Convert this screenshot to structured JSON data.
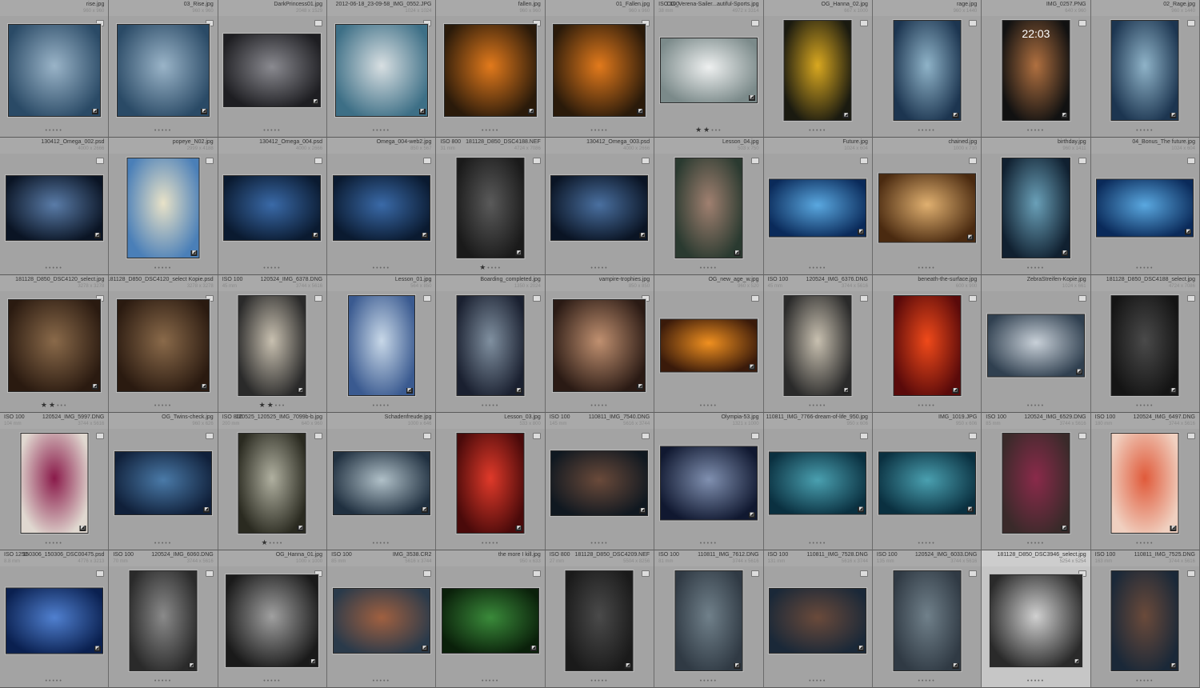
{
  "rows": [
    [
      {
        "name": "rise.jpg",
        "dims": "960 x 960",
        "w": 960,
        "h": 960,
        "stars": 0,
        "c": [
          "#2a4a66",
          "#9ab4c8"
        ]
      },
      {
        "name": "03_Rise.jpg",
        "dims": "960 x 960",
        "w": 960,
        "h": 960,
        "stars": 0,
        "c": [
          "#2a4a66",
          "#9ab4c8"
        ]
      },
      {
        "name": "DarkPrincess01.jpg",
        "dims": "2048 x 1529",
        "w": 2048,
        "h": 1529,
        "stars": 0,
        "c": [
          "#1e1e22",
          "#8a8a90"
        ]
      },
      {
        "name": "2012-06-18_23-09-58_IMG_0552.JPG",
        "dims": "1024 x 1024",
        "w": 1024,
        "h": 1024,
        "stars": 0,
        "c": [
          "#3d6f86",
          "#d8dfe2"
        ]
      },
      {
        "name": "fallen.jpg",
        "dims": "960 x 960",
        "w": 960,
        "h": 960,
        "stars": 0,
        "c": [
          "#2a1a0a",
          "#e27a1c"
        ]
      },
      {
        "name": "01_Fallen.jpg",
        "dims": "960 x 960",
        "w": 960,
        "h": 960,
        "stars": 0,
        "c": [
          "#2a1a0a",
          "#e27a1c"
        ]
      },
      {
        "name": "OG_Verena-Sailer...autiful-Sports.jpg",
        "dims": "4972 x 3314",
        "iso": "ISO 100",
        "focal": "38 mm",
        "w": 4972,
        "h": 3314,
        "stars": 2,
        "c": [
          "#7b8a8a",
          "#eef0f0"
        ]
      },
      {
        "name": "OG_Hanna_02.jpg",
        "dims": "667 x 1000",
        "w": 667,
        "h": 1000,
        "stars": 0,
        "c": [
          "#1a1a10",
          "#d9a820"
        ]
      },
      {
        "name": "rage.jpg",
        "dims": "960 x 1440",
        "w": 960,
        "h": 1440,
        "stars": 0,
        "c": [
          "#1c3550",
          "#8fb3c8"
        ]
      },
      {
        "name": "IMG_0257.PNG",
        "dims": "640 x 960",
        "w": 640,
        "h": 960,
        "stars": 0,
        "c": [
          "#111111",
          "#b07040"
        ],
        "clock": "22:03"
      },
      {
        "name": "02_Rage.jpg",
        "dims": "960 x 1440",
        "w": 960,
        "h": 1440,
        "stars": 0,
        "c": [
          "#1c3550",
          "#8fb3c8"
        ]
      }
    ],
    [
      {
        "name": "130412_Omega_002.psd",
        "dims": "4000 x 2666",
        "w": 4000,
        "h": 2666,
        "stars": 0,
        "c": [
          "#0a1424",
          "#5a7ca8"
        ]
      },
      {
        "name": "popeye_N02.jpg",
        "dims": "2999 x 4188",
        "w": 2999,
        "h": 4188,
        "stars": 0,
        "c": [
          "#4a7fb8",
          "#e8e2c8"
        ]
      },
      {
        "name": "130412_Omega_004.psd",
        "dims": "4000 x 2666",
        "w": 4000,
        "h": 2666,
        "stars": 0,
        "c": [
          "#0a1a30",
          "#3a6aa8"
        ]
      },
      {
        "name": "Omega_004-web2.jpg",
        "dims": "850 x 567",
        "w": 850,
        "h": 567,
        "stars": 0,
        "c": [
          "#0a1a30",
          "#3a6aa8"
        ]
      },
      {
        "name": "181128_D850_DSC4188.NEF",
        "dims": "4724 x 7086",
        "iso": "ISO 800",
        "focal": "31 mm",
        "w": 4724,
        "h": 7086,
        "stars": 1,
        "c": [
          "#1a1a1a",
          "#5a5a5a"
        ]
      },
      {
        "name": "130412_Omega_003.psd",
        "dims": "4000 x 2666",
        "w": 4000,
        "h": 2666,
        "stars": 0,
        "c": [
          "#0a1424",
          "#4a70a0"
        ]
      },
      {
        "name": "Lesson_04.jpg",
        "dims": "503 x 750",
        "w": 503,
        "h": 750,
        "stars": 0,
        "c": [
          "#2a3a30",
          "#a08070"
        ]
      },
      {
        "name": "Future.jpg",
        "dims": "1024 x 604",
        "w": 1024,
        "h": 604,
        "stars": 0,
        "c": [
          "#0a2a5a",
          "#5aa8e0"
        ]
      },
      {
        "name": "chained.jpg",
        "dims": "1000 x 710",
        "w": 1000,
        "h": 710,
        "stars": 0,
        "c": [
          "#4a2a10",
          "#e0b070"
        ]
      },
      {
        "name": "birthday.jpg",
        "dims": "960 x 1411",
        "w": 960,
        "h": 1411,
        "stars": 0,
        "c": [
          "#102030",
          "#6aa0b8"
        ]
      },
      {
        "name": "04_Bonus_The future.jpg",
        "dims": "1024 x 604",
        "w": 1024,
        "h": 604,
        "stars": 0,
        "c": [
          "#0a2a5a",
          "#5aa8e0"
        ]
      }
    ],
    [
      {
        "name": "181128_D850_DSC4120_select.jpg",
        "dims": "3278 x 3278",
        "w": 3278,
        "h": 3278,
        "stars": 2,
        "c": [
          "#2a1a10",
          "#8a6a4a"
        ]
      },
      {
        "name": "181128_D850_DSC4120_select Kopie.psd",
        "dims": "3278 x 3278",
        "w": 3278,
        "h": 3278,
        "stars": 0,
        "c": [
          "#2a1a10",
          "#8a6a4a"
        ]
      },
      {
        "name": "120524_IMG_6378.DNG",
        "dims": "3744 x 5616",
        "iso": "ISO 100",
        "focal": "45 mm",
        "w": 3744,
        "h": 5616,
        "stars": 2,
        "c": [
          "#2a2a2a",
          "#c8c0b0"
        ]
      },
      {
        "name": "Lesson_01.jpg",
        "dims": "564 x 850",
        "w": 564,
        "h": 850,
        "stars": 0,
        "c": [
          "#3a5a90",
          "#c8d8e8"
        ]
      },
      {
        "name": "Boarding_completed.jpg",
        "dims": "1350 x 2024",
        "w": 1350,
        "h": 2024,
        "stars": 0,
        "c": [
          "#1a2030",
          "#8090a0"
        ]
      },
      {
        "name": "vampire-trophies.jpg",
        "dims": "850 x 850",
        "w": 850,
        "h": 850,
        "stars": 0,
        "c": [
          "#2a1a14",
          "#c09070"
        ]
      },
      {
        "name": "OG_new_age_w.jpg",
        "dims": "960 x 520",
        "w": 960,
        "h": 520,
        "stars": 0,
        "c": [
          "#3a1a0a",
          "#f09020"
        ]
      },
      {
        "name": "120524_IMG_6376.DNG",
        "dims": "3744 x 5616",
        "iso": "ISO 100",
        "focal": "45 mm",
        "w": 3744,
        "h": 5616,
        "stars": 0,
        "c": [
          "#2a2a2a",
          "#c8c0b0"
        ]
      },
      {
        "name": "beneath-the-surface.jpg",
        "dims": "600 x 900",
        "w": 600,
        "h": 900,
        "stars": 0,
        "c": [
          "#5a0a0a",
          "#f04a1a"
        ]
      },
      {
        "name": "ZebraStreifen-Kopie.jpg",
        "dims": "1024 x 661",
        "w": 1024,
        "h": 661,
        "stars": 0,
        "c": [
          "#304050",
          "#c8d0d8"
        ]
      },
      {
        "name": "181128_D850_DSC4188_select.jpg",
        "dims": "4724 x 7086",
        "w": 4724,
        "h": 7086,
        "stars": 0,
        "c": [
          "#141414",
          "#4a4a4a"
        ]
      }
    ],
    [
      {
        "name": "120524_IMG_5997.DNG",
        "dims": "3744 x 5616",
        "iso": "ISO 100",
        "focal": "104 mm",
        "w": 3744,
        "h": 5616,
        "stars": 0,
        "c": [
          "#e0d8d0",
          "#8a1a4a"
        ]
      },
      {
        "name": "OG_Twins-check.jpg",
        "dims": "960 x 626",
        "w": 960,
        "h": 626,
        "stars": 0,
        "c": [
          "#10203a",
          "#4a7aa8"
        ]
      },
      {
        "name": "120525_120525_IMG_7099b-b.jpg",
        "dims": "640 x 960",
        "iso": "ISO 800",
        "focal": "200 mm",
        "w": 640,
        "h": 960,
        "stars": 1,
        "c": [
          "#2a2a20",
          "#b0b0a0"
        ]
      },
      {
        "name": "Schadenfreude.jpg",
        "dims": "1000 x 646",
        "w": 1000,
        "h": 646,
        "stars": 0,
        "c": [
          "#203040",
          "#b0c0c8"
        ]
      },
      {
        "name": "Lesson_03.jpg",
        "dims": "533 x 800",
        "w": 533,
        "h": 800,
        "stars": 0,
        "c": [
          "#4a0a0a",
          "#e03a2a"
        ]
      },
      {
        "name": "110811_IMG_7540.DNG",
        "dims": "5616 x 3744",
        "iso": "ISO 100",
        "focal": "145 mm",
        "w": 5616,
        "h": 3744,
        "stars": 0,
        "c": [
          "#101820",
          "#6a4a3a"
        ]
      },
      {
        "name": "Olympia-53.jpg",
        "dims": "1321 x 1000",
        "w": 1321,
        "h": 1000,
        "stars": 0,
        "c": [
          "#101830",
          "#8090b0"
        ]
      },
      {
        "name": "110811_IMG_7766-dream-of-life_950.jpg",
        "dims": "950 x 606",
        "w": 950,
        "h": 606,
        "stars": 0,
        "c": [
          "#0a3040",
          "#4aa0b0"
        ]
      },
      {
        "name": "IMG_1019.JPG",
        "dims": "950 x 606",
        "w": 950,
        "h": 606,
        "stars": 0,
        "c": [
          "#0a3040",
          "#4aa0b0"
        ]
      },
      {
        "name": "120524_IMG_6529.DNG",
        "dims": "3744 x 5616",
        "iso": "ISO 100",
        "focal": "85 mm",
        "w": 3744,
        "h": 5616,
        "stars": 0,
        "c": [
          "#3a2a2a",
          "#8a2a4a"
        ]
      },
      {
        "name": "120524_IMG_6497.DNG",
        "dims": "3744 x 5616",
        "iso": "ISO 100",
        "focal": "180 mm",
        "w": 3744,
        "h": 5616,
        "stars": 0,
        "c": [
          "#f0d0c0",
          "#e05a3a"
        ]
      }
    ],
    [
      {
        "name": "150306_150306_DSC00475.psd",
        "dims": "4776 x 3213",
        "iso": "ISO 1250",
        "focal": "8.8 mm",
        "w": 4776,
        "h": 3213,
        "stars": 0,
        "c": [
          "#0a2050",
          "#5080d0"
        ]
      },
      {
        "name": "120524_IMG_6060.DNG",
        "dims": "3744 x 5616",
        "iso": "ISO 100",
        "focal": "70 mm",
        "w": 3744,
        "h": 5616,
        "stars": 0,
        "c": [
          "#2a2a2a",
          "#8a8a8a"
        ]
      },
      {
        "name": "OG_Hanna_01.jpg",
        "dims": "1000 x 1000",
        "w": 1000,
        "h": 1000,
        "stars": 0,
        "c": [
          "#1a1a1a",
          "#a0a0a0"
        ]
      },
      {
        "name": "IMG_3538.CR2",
        "dims": "5616 x 3744",
        "iso": "ISO 100",
        "focal": "85 mm",
        "w": 5616,
        "h": 3744,
        "stars": 0,
        "c": [
          "#2a3a4a",
          "#a06040"
        ]
      },
      {
        "name": "the more I kill.jpg",
        "dims": "950 x 633",
        "w": 950,
        "h": 633,
        "stars": 0,
        "c": [
          "#0a200a",
          "#3a8a3a"
        ]
      },
      {
        "name": "181128_D850_DSC4209.NEF",
        "dims": "5504 x 8256",
        "iso": "ISO 800",
        "focal": "27 mm",
        "w": 5504,
        "h": 8256,
        "stars": 0,
        "c": [
          "#1a1a1a",
          "#4a4a4a"
        ]
      },
      {
        "name": "110811_IMG_7612.DNG",
        "dims": "3744 x 5616",
        "iso": "ISO 100",
        "focal": "81 mm",
        "w": 3744,
        "h": 5616,
        "stars": 0,
        "c": [
          "#303a44",
          "#70808a"
        ]
      },
      {
        "name": "110811_IMG_7528.DNG",
        "dims": "5616 x 3744",
        "iso": "ISO 100",
        "focal": "131 mm",
        "w": 5616,
        "h": 3744,
        "stars": 0,
        "c": [
          "#1a2838",
          "#6a4a3a"
        ]
      },
      {
        "name": "120524_IMG_6033.DNG",
        "dims": "3744 x 5616",
        "iso": "ISO 100",
        "focal": "135 mm",
        "w": 3744,
        "h": 5616,
        "stars": 0,
        "c": [
          "#303a44",
          "#70808a"
        ]
      },
      {
        "name": "181128_D850_DSC3946_select.jpg",
        "dims": "5254 x 5254",
        "w": 5254,
        "h": 5254,
        "stars": 0,
        "c": [
          "#2a2a2a",
          "#d0d0d0"
        ],
        "selected": true
      },
      {
        "name": "110811_IMG_7525.DNG",
        "dims": "3744 x 5616",
        "iso": "ISO 100",
        "focal": "163 mm",
        "w": 3744,
        "h": 5616,
        "stars": 0,
        "c": [
          "#1a2838",
          "#6a4a3a"
        ]
      }
    ]
  ]
}
